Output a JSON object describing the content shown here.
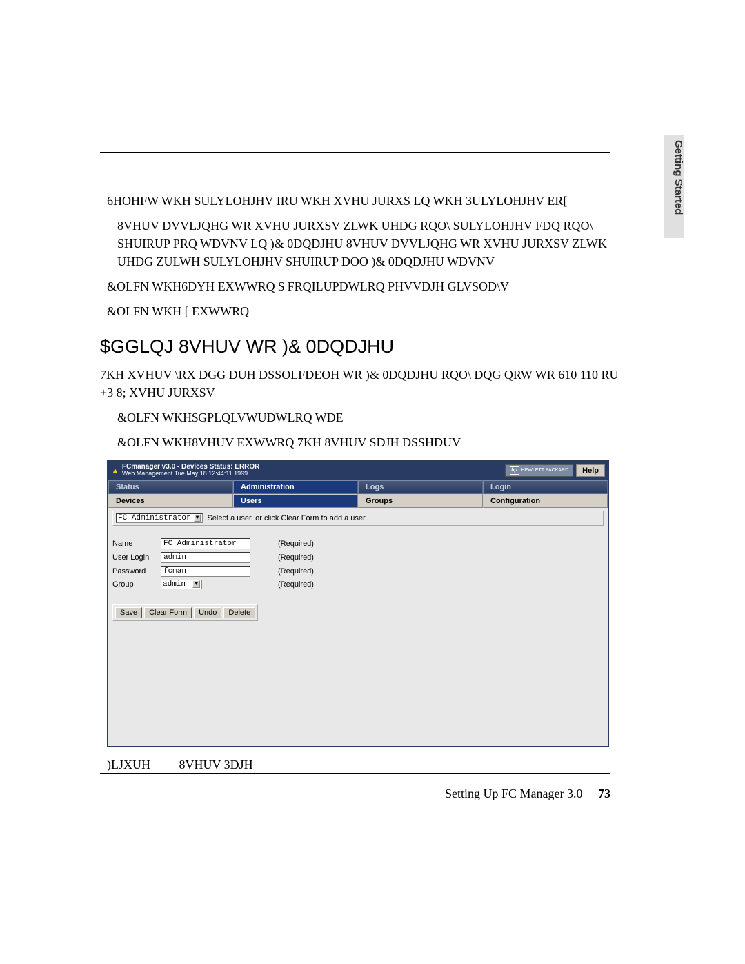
{
  "sideTab": "Getting Started",
  "paragraphs": {
    "p1": "6HOHFW WKH SULYLOHJHV IRU WKH XVHU JURXS LQ WKH 3ULYLOHJHV ER[",
    "p2": "8VHUV DVVLJQHG WR XVHU JURXSV ZLWK UHDG RQO\\ SULYLOHJHV FDQ RQO\\ SHUIRUP PRQ WDVNV LQ )& 0DQDJHU  8VHUV DVVLJQHG WR XVHU JURXSV ZLWK UHDG ZULWH SULYLOHJHV SHUIRUP DOO )& 0DQDJHU WDVNV",
    "p3": "&OLFN WKH6DYH EXWWRQ  $ FRQILUPDWLRQ PHVVDJH GLVSOD\\V",
    "p4": "&OLFN WKH [ EXWWRQ",
    "p5": "7KH XVHUV \\RX DGG DUH DSSOLFDEOH WR )& 0DQDJHU RQO\\ DQG QRW WR 610  110  RU +3 8; XVHU JURXSV",
    "p6": "&OLFN WKH$GPLQLVWUDWLRQ WDE",
    "p7": "&OLFN WKH8VHUV EXWWRQ  7KH 8VHUV SDJH DSSHDUV"
  },
  "heading": "$GGLQJ 8VHUV WR )& 0DQDJHU",
  "app": {
    "titleLine1": "FCmanager v3.0 - Devices Status: ERROR",
    "titleLine2": "Web Management Tue May 18 12:44:11 1999",
    "hpLogoText": "HEWLETT PACKARD",
    "hpBadge": "hp",
    "helpBtn": "Help",
    "tabs": {
      "status": "Status",
      "admin": "Administration",
      "logs": "Logs",
      "login": "Login"
    },
    "subtabs": {
      "devices": "Devices",
      "users": "Users",
      "groups": "Groups",
      "config": "Configuration"
    },
    "topSelectValue": "FC Administrator",
    "topInstruct": "Select a user, or click Clear Form to add a user.",
    "form": {
      "nameLabel": "Name",
      "nameValue": "FC Administrator",
      "nameReq": "(Required)",
      "loginLabel": "User Login",
      "loginValue": "admin",
      "loginReq": "(Required)",
      "pwLabel": "Password",
      "pwValue": "fcman",
      "pwReq": "(Required)",
      "groupLabel": "Group",
      "groupValue": "admin",
      "groupReq": "(Required)"
    },
    "buttons": {
      "save": "Save",
      "clear": "Clear Form",
      "undo": "Undo",
      "delete": "Delete"
    }
  },
  "figure": {
    "label": ")LJXUH",
    "caption": "8VHUV 3DJH"
  },
  "footer": {
    "text": "Setting Up FC Manager 3.0",
    "page": "73"
  }
}
